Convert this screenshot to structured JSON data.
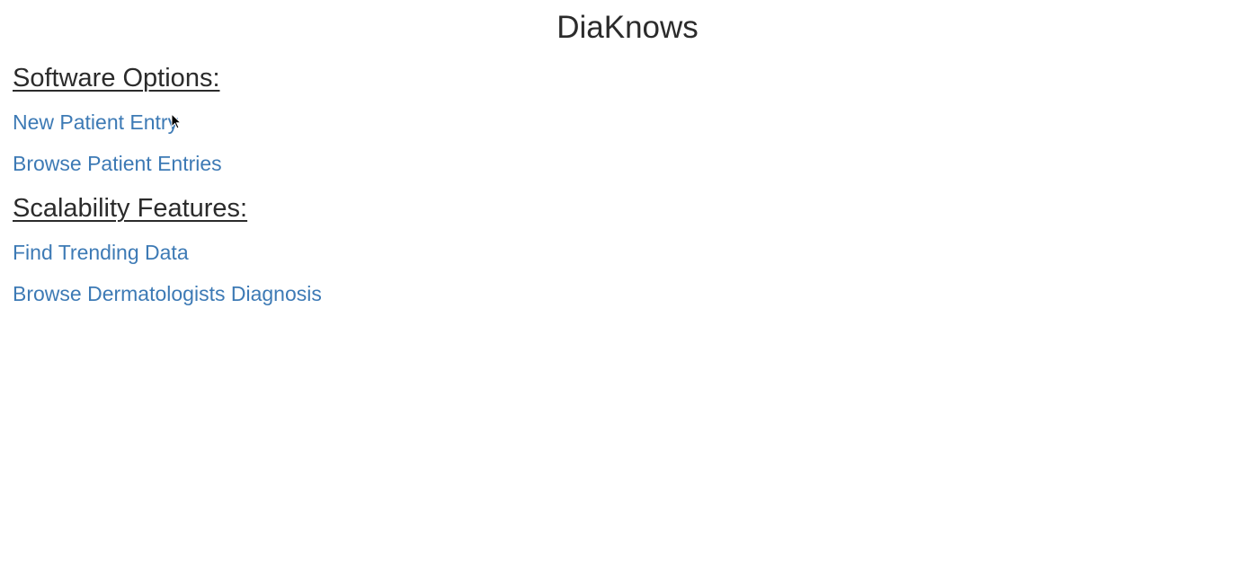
{
  "header": {
    "title": "DiaKnows"
  },
  "sections": [
    {
      "heading": "Software Options:",
      "links": [
        {
          "label": "New Patient Entry"
        },
        {
          "label": "Browse Patient Entries"
        }
      ]
    },
    {
      "heading": "Scalability Features:",
      "links": [
        {
          "label": "Find Trending Data"
        },
        {
          "label": "Browse Dermatologists Diagnosis"
        }
      ]
    }
  ],
  "colors": {
    "text": "#2b2b2b",
    "link": "#3d7ab5",
    "background": "#ffffff"
  },
  "icons": {
    "cursor": "mouse-pointer-icon"
  }
}
